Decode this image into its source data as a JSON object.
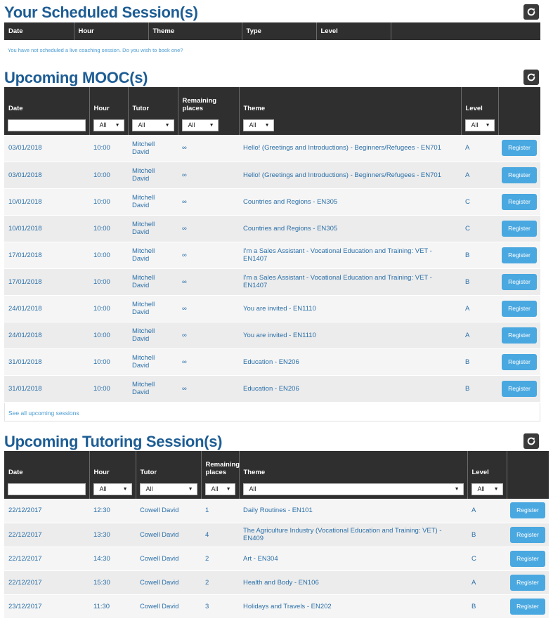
{
  "scheduled": {
    "title": "Your Scheduled Session(s)",
    "headers": [
      "Date",
      "Hour",
      "Theme",
      "Type",
      "Level",
      ""
    ],
    "notice": "You have not scheduled a live coaching session. Do you wish to book one?"
  },
  "mooc": {
    "title": "Upcoming MOOC(s)",
    "headers": [
      "Date",
      "Hour",
      "Tutor",
      "Remaining places",
      "Theme",
      "Level",
      ""
    ],
    "filters": {
      "hour": "All",
      "tutor": "All",
      "places": "All",
      "theme": "All",
      "level": "All"
    },
    "rows": [
      {
        "date": "03/01/2018",
        "hour": "10:00",
        "tutor": "Mitchell David",
        "places": "∞",
        "theme": "Hello! (Greetings and Introductions) - Beginners/Refugees - EN701",
        "level": "A",
        "action": "Register"
      },
      {
        "date": "03/01/2018",
        "hour": "10:00",
        "tutor": "Mitchell David",
        "places": "∞",
        "theme": "Hello! (Greetings and Introductions) - Beginners/Refugees - EN701",
        "level": "A",
        "action": "Register"
      },
      {
        "date": "10/01/2018",
        "hour": "10:00",
        "tutor": "Mitchell David",
        "places": "∞",
        "theme": "Countries and Regions - EN305",
        "level": "C",
        "action": "Register"
      },
      {
        "date": "10/01/2018",
        "hour": "10:00",
        "tutor": "Mitchell David",
        "places": "∞",
        "theme": "Countries and Regions - EN305",
        "level": "C",
        "action": "Register"
      },
      {
        "date": "17/01/2018",
        "hour": "10:00",
        "tutor": "Mitchell David",
        "places": "∞",
        "theme": "I'm a Sales Assistant - Vocational Education and Training: VET - EN1407",
        "level": "B",
        "action": "Register"
      },
      {
        "date": "17/01/2018",
        "hour": "10:00",
        "tutor": "Mitchell David",
        "places": "∞",
        "theme": "I'm a Sales Assistant - Vocational Education and Training: VET - EN1407",
        "level": "B",
        "action": "Register"
      },
      {
        "date": "24/01/2018",
        "hour": "10:00",
        "tutor": "Mitchell David",
        "places": "∞",
        "theme": "You are invited - EN1110",
        "level": "A",
        "action": "Register"
      },
      {
        "date": "24/01/2018",
        "hour": "10:00",
        "tutor": "Mitchell David",
        "places": "∞",
        "theme": "You are invited - EN1110",
        "level": "A",
        "action": "Register"
      },
      {
        "date": "31/01/2018",
        "hour": "10:00",
        "tutor": "Mitchell David",
        "places": "∞",
        "theme": "Education - EN206",
        "level": "B",
        "action": "Register"
      },
      {
        "date": "31/01/2018",
        "hour": "10:00",
        "tutor": "Mitchell David",
        "places": "∞",
        "theme": "Education - EN206",
        "level": "B",
        "action": "Register"
      }
    ],
    "see_all": "See all upcoming sessions"
  },
  "tutoring": {
    "title": "Upcoming Tutoring Session(s)",
    "headers": [
      "Date",
      "Hour",
      "Tutor",
      "Remaining places",
      "Theme",
      "Level",
      ""
    ],
    "filters": {
      "hour": "All",
      "tutor": "All",
      "places": "All",
      "theme": "All",
      "level": "All"
    },
    "rows": [
      {
        "date": "22/12/2017",
        "hour": "12:30",
        "tutor": "Cowell David",
        "places": "1",
        "theme": "Daily Routines - EN101",
        "level": "A",
        "action": "Register"
      },
      {
        "date": "22/12/2017",
        "hour": "13:30",
        "tutor": "Cowell David",
        "places": "4",
        "theme": "The Agriculture Industry (Vocational Education and Training: VET) - EN409",
        "level": "B",
        "action": "Register"
      },
      {
        "date": "22/12/2017",
        "hour": "14:30",
        "tutor": "Cowell David",
        "places": "2",
        "theme": "Art - EN304",
        "level": "C",
        "action": "Register"
      },
      {
        "date": "22/12/2017",
        "hour": "15:30",
        "tutor": "Cowell David",
        "places": "2",
        "theme": "Health and Body - EN106",
        "level": "A",
        "action": "Register"
      },
      {
        "date": "23/12/2017",
        "hour": "11:30",
        "tutor": "Cowell David",
        "places": "3",
        "theme": "Holidays and Travels - EN202",
        "level": "B",
        "action": "Register"
      }
    ]
  },
  "icons": {
    "refresh": "refresh-icon"
  },
  "colors": {
    "title": "#1d5d94",
    "header_bg": "#2f2f2f",
    "link": "#2a6fa8",
    "button": "#4aa8e0"
  }
}
